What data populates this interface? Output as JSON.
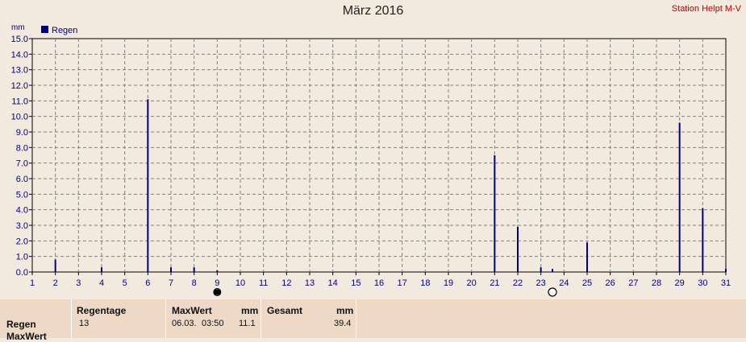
{
  "header": {
    "title": "März 2016",
    "station": "Station Helpt M-V"
  },
  "chart_data": {
    "type": "bar",
    "ylabel": "mm",
    "ylim": [
      0,
      15
    ],
    "yticks": [
      "0.0",
      "1.0",
      "2.0",
      "3.0",
      "4.0",
      "5.0",
      "6.0",
      "7.0",
      "8.0",
      "9.0",
      "10.0",
      "11.0",
      "12.0",
      "13.0",
      "14.0",
      "15.0"
    ],
    "xlim": [
      1,
      31
    ],
    "xticks": [
      "1",
      "2",
      "3",
      "4",
      "5",
      "6",
      "7",
      "8",
      "9",
      "10",
      "11",
      "12",
      "13",
      "14",
      "15",
      "16",
      "17",
      "18",
      "19",
      "20",
      "21",
      "22",
      "23",
      "24",
      "25",
      "26",
      "27",
      "28",
      "29",
      "30",
      "31"
    ],
    "grid": true,
    "legend": "top-left",
    "series": [
      {
        "name": "Regen",
        "color": "#000080",
        "points": [
          {
            "x": 2,
            "y": 0.8
          },
          {
            "x": 4,
            "y": 0.3
          },
          {
            "x": 6,
            "y": 11.1
          },
          {
            "x": 7,
            "y": 0.3
          },
          {
            "x": 8,
            "y": 0.3
          },
          {
            "x": 9,
            "y": 0.1
          },
          {
            "x": 21,
            "y": 7.5
          },
          {
            "x": 22,
            "y": 2.9
          },
          {
            "x": 23,
            "y": 0.3
          },
          {
            "x": 23.5,
            "y": 0.2
          },
          {
            "x": 25,
            "y": 1.9
          },
          {
            "x": 29,
            "y": 9.6
          },
          {
            "x": 30,
            "y": 4.1
          },
          {
            "x": 31,
            "y": 0.2
          }
        ]
      }
    ],
    "moon_phases": [
      {
        "x": 9,
        "phase": "new-moon"
      },
      {
        "x": 23.5,
        "phase": "full-moon"
      }
    ]
  },
  "summary": {
    "row_label": "Regen",
    "row_label2": "MaxWert",
    "regentage_label": "Regentage",
    "regentage_value": "13",
    "maxwert_label": "MaxWert",
    "maxwert_unit": "mm",
    "maxwert_date": "06.03.",
    "maxwert_time": "03:50",
    "maxwert_value": "11.1",
    "gesamt_label": "Gesamt",
    "gesamt_unit": "mm",
    "gesamt_value": "39.4"
  }
}
